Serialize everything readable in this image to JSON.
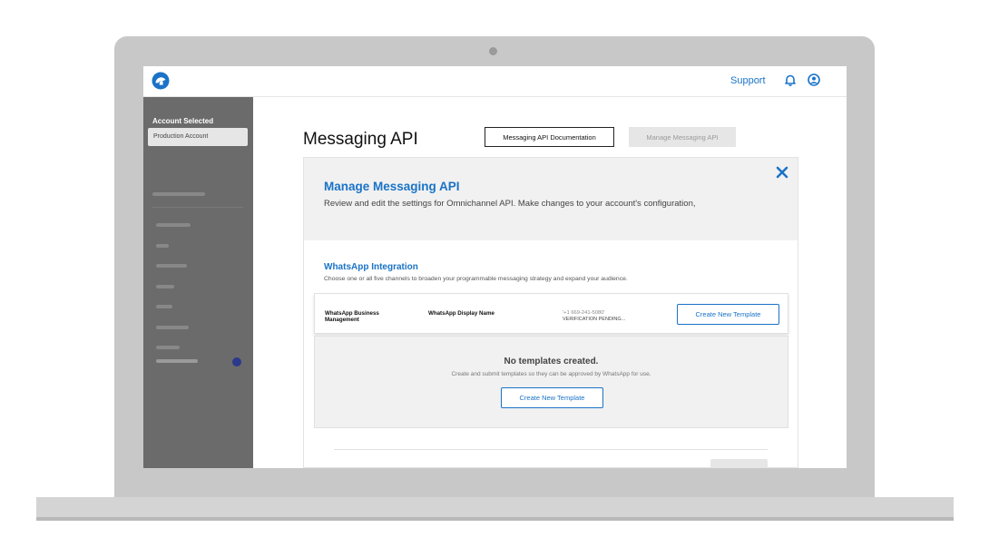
{
  "topbar": {
    "support_label": "Support",
    "logo_icon": "brand-logo-icon",
    "bell_icon": "bell-icon",
    "user_icon": "user-icon",
    "accent_color": "#1a73c7"
  },
  "sidebar": {
    "account_label": "Account Selected",
    "account_value": "Production Account"
  },
  "main": {
    "title": "Messaging API",
    "doc_button": "Messaging API Documentation",
    "manage_button": "Manage Messaging API"
  },
  "panel": {
    "title": "Manage Messaging API",
    "subtitle": "Review and edit the settings for Omnichannel API. Make changes to your account's configuration,",
    "close_icon": "close-icon"
  },
  "whatsapp": {
    "title": "WhatsApp Integration",
    "subtitle": "Choose one or all five channels to broaden your programmable messaging strategy and expand your audience.",
    "management": "WhatsApp Business Management",
    "display_name": "WhatsApp Display Name",
    "phone": "'+1 669-241-5080'",
    "status": "VERIFICATION PENDING...",
    "create_button": "Create New Template"
  },
  "templates": {
    "empty_title": "No templates created.",
    "empty_subtitle": "Create and submit templates so they can be approved by WhatsApp for use.",
    "create_button": "Create New Template"
  }
}
